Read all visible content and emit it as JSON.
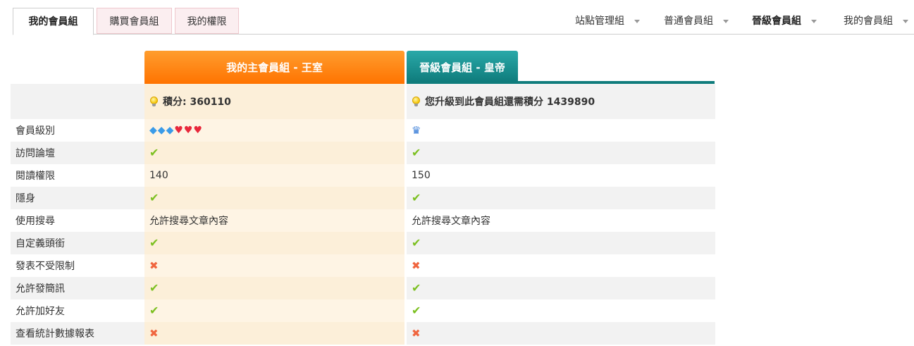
{
  "tabs": [
    {
      "label": "我的會員組"
    },
    {
      "label": "購買會員組"
    },
    {
      "label": "我的權限"
    }
  ],
  "right_nav": [
    {
      "label": "站點管理組"
    },
    {
      "label": "普通會員組"
    },
    {
      "label": "晉級會員組"
    },
    {
      "label": "我的會員組"
    }
  ],
  "headers": {
    "mine": "我的主會員組 - 王室",
    "next": "晉級會員組 - 皇帝"
  },
  "top_row": {
    "mine": "積分: 360110",
    "next": "您升級到此會員組還需積分 1439890"
  },
  "rows": [
    {
      "label": "會員級別",
      "mine": "gems",
      "next": "crown"
    },
    {
      "label": "訪問論壇",
      "mine": "check",
      "next": "check"
    },
    {
      "label": "閱讀權限",
      "mine": "140",
      "next": "150"
    },
    {
      "label": "隱身",
      "mine": "check",
      "next": "check"
    },
    {
      "label": "使用搜尋",
      "mine": "允許搜尋文章內容",
      "next": "允許搜尋文章內容"
    },
    {
      "label": "自定義頭銜",
      "mine": "check",
      "next": "check"
    },
    {
      "label": "發表不受限制",
      "mine": "cross",
      "next": "cross"
    },
    {
      "label": "允許發簡訊",
      "mine": "check",
      "next": "check"
    },
    {
      "label": "允許加好友",
      "mine": "check",
      "next": "check"
    },
    {
      "label": "查看統計數據報表",
      "mine": "cross",
      "next": "cross"
    }
  ],
  "colors": {
    "orange_header": "#ff7300",
    "teal_header": "#0f7c7c",
    "check": "#7cc021",
    "cross": "#f0653f"
  }
}
